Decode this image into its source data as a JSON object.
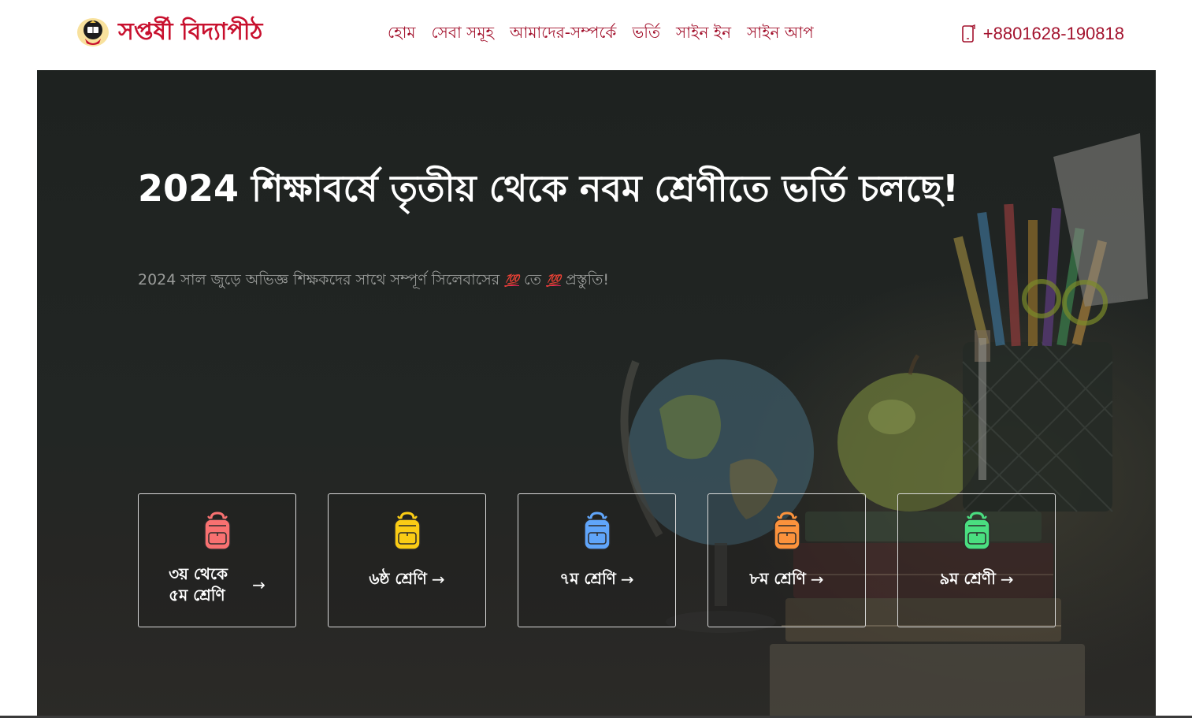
{
  "header": {
    "logo_text": "সপ্তর্ষী বিদ্যাপীঠ",
    "nav": [
      {
        "label": "হোম"
      },
      {
        "label": "সেবা সমূহ"
      },
      {
        "label": "আমাদের-সম্পর্কে"
      },
      {
        "label": "ভর্তি"
      },
      {
        "label": "সাইন ইন"
      },
      {
        "label": "সাইন আপ"
      }
    ],
    "phone": "+8801628-190818",
    "phone_icon": "phone-icon"
  },
  "hero": {
    "title": "2024 শিক্ষাবর্ষে তৃতীয় থেকে নবম শ্রেণীতে ভর্তি চলছে!",
    "subtitle_part1": "2024 সাল জুড়ে অভিজ্ঞ শিক্ষকদের সাথে সম্পূর্ণ সিলেবাসের",
    "subtitle_emoji": "💯",
    "subtitle_part2": "তে",
    "subtitle_part3": "প্রস্তুতি!",
    "cards": [
      {
        "label": "৩য় থেকে ৫ম শ্রেণি",
        "icon": "backpack-icon",
        "color": "#f87171"
      },
      {
        "label": "৬ষ্ঠ শ্রেণি",
        "icon": "backpack-icon",
        "color": "#facc15"
      },
      {
        "label": "৭ম শ্রেণি",
        "icon": "backpack-icon",
        "color": "#60a5fa"
      },
      {
        "label": "৮ম শ্রেণি",
        "icon": "backpack-icon",
        "color": "#fb923c"
      },
      {
        "label": "৯ম শ্রেণী",
        "icon": "backpack-icon",
        "color": "#4ade80"
      }
    ],
    "arrow": "→"
  },
  "colors": {
    "brand": "#c8102e",
    "nav_text": "#a3122d"
  }
}
